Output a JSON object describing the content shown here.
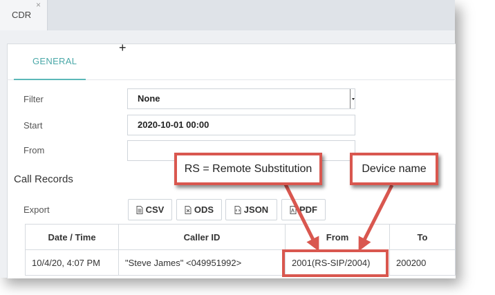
{
  "tabs": [
    {
      "label": "CDR",
      "close": "×"
    }
  ],
  "subtabs": [
    {
      "label": "GENERAL"
    }
  ],
  "filter": {
    "label": "Filter",
    "value": "None"
  },
  "start": {
    "label": "Start",
    "value": "2020-10-01 00:00"
  },
  "from": {
    "label": "From",
    "value": ""
  },
  "section_title": "Call Records",
  "export": {
    "label": "Export",
    "buttons": [
      "CSV",
      "ODS",
      "JSON",
      "PDF"
    ]
  },
  "table": {
    "columns": [
      "Date / Time",
      "Caller ID",
      "From",
      "To"
    ],
    "rows": [
      [
        "10/4/20, 4:07 PM",
        "\"Steve James\" <049951992>",
        "2001(RS-SIP/2004)",
        "200200"
      ]
    ]
  },
  "annotations": {
    "rs_note": "RS = Remote Substitution",
    "device_note": "Device name"
  },
  "colors": {
    "accent": "#4aa8a8",
    "annotation": "#d9574f"
  }
}
